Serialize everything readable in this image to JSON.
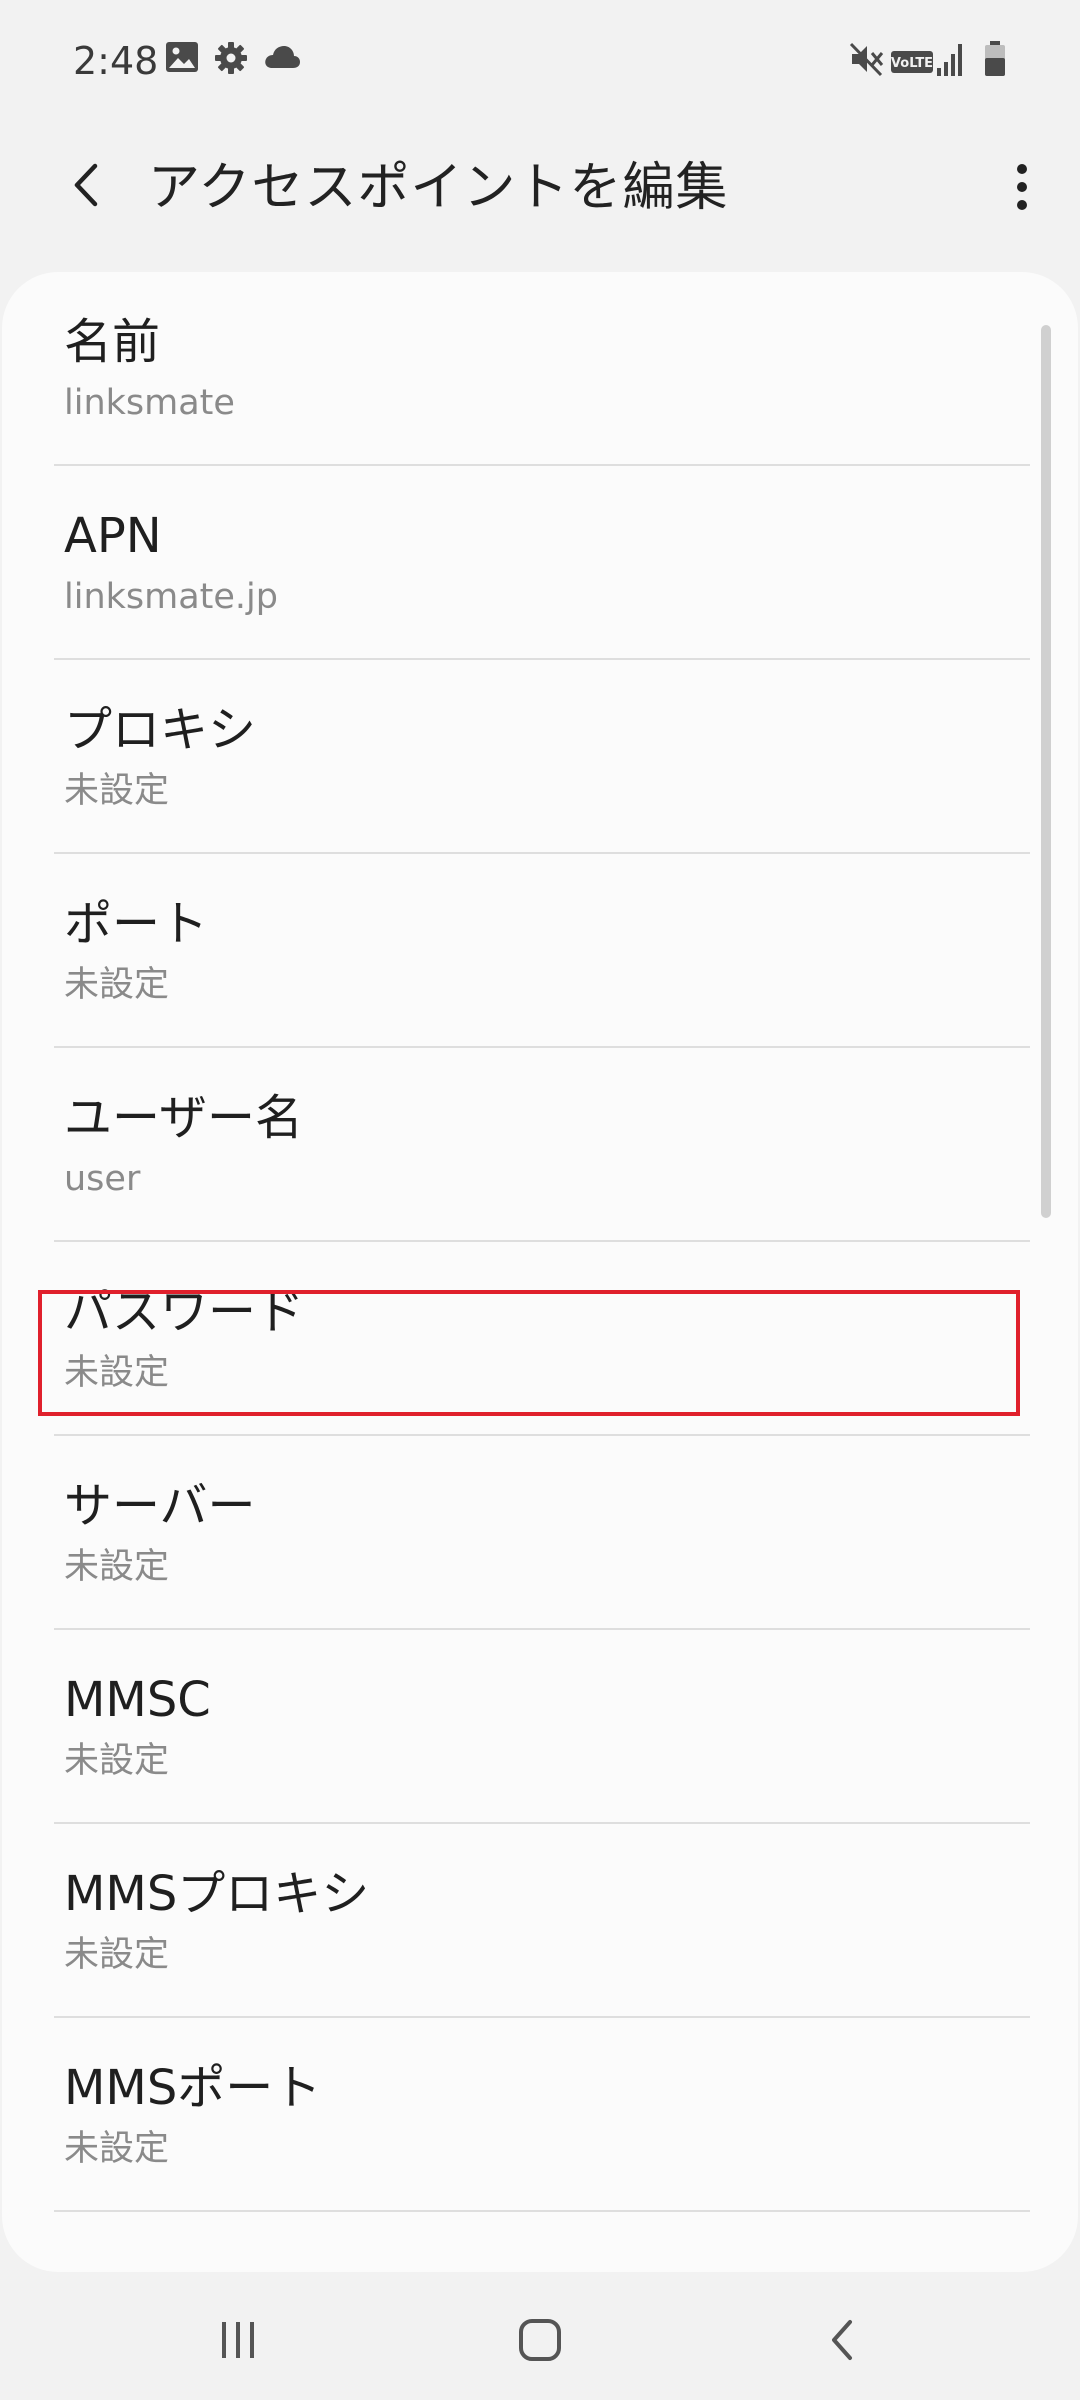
{
  "status_bar": {
    "time": "2:48",
    "left_icons": [
      "gallery-icon",
      "settings-gear-icon",
      "cloud-icon"
    ],
    "right_icons": [
      "mute-icon",
      "volte-icon",
      "signal-icon",
      "battery-icon"
    ],
    "volte_label": "VoLTE"
  },
  "app_bar": {
    "title": "アクセスポイントを編集",
    "back_icon": "chevron-left-icon",
    "more_icon": "more-vertical-icon"
  },
  "items": [
    {
      "title": "名前",
      "value": "linksmate"
    },
    {
      "title": "APN",
      "value": "linksmate.jp"
    },
    {
      "title": "プロキシ",
      "value": "未設定"
    },
    {
      "title": "ポート",
      "value": "未設定"
    },
    {
      "title": "ユーザー名",
      "value": "user"
    },
    {
      "title": "パスワード",
      "value": "未設定"
    },
    {
      "title": "サーバー",
      "value": "未設定"
    },
    {
      "title": "MMSC",
      "value": "未設定"
    },
    {
      "title": "MMSプロキシ",
      "value": "未設定"
    },
    {
      "title": "MMSポート",
      "value": "未設定"
    }
  ],
  "highlighted_item": "パスワード",
  "colors": {
    "background": "#f2f2f2",
    "card": "#fbfbfb",
    "highlight": "#e0202c",
    "secondary_text": "#8a8a8a"
  },
  "nav_bar": {
    "icons": [
      "recent-apps-icon",
      "home-icon",
      "back-nav-icon"
    ]
  }
}
